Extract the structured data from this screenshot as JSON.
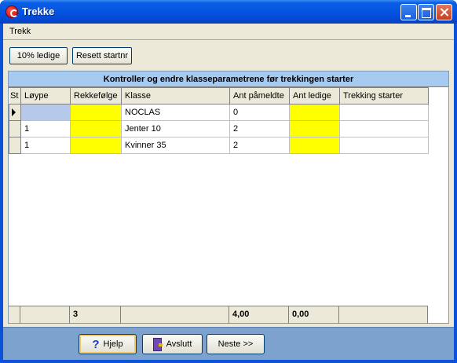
{
  "window": {
    "title": "Trekke"
  },
  "menu": {
    "items": [
      "Trekk"
    ]
  },
  "toolbar": {
    "buttons": [
      "10% ledige",
      "Resett startnr"
    ]
  },
  "grid": {
    "caption": "Kontroller og endre klasseparametrene før trekkingen starter",
    "columns": [
      "St",
      "Løype",
      "Rekkefølge",
      "Klasse",
      "Ant påmeldte",
      "Ant ledige",
      "Trekking starter"
    ],
    "rows": [
      {
        "indicator": "current",
        "løype": "",
        "rekkefølge": "",
        "klasse": "NOCLAS",
        "ant_påmeldte": "0",
        "ant_ledige": "",
        "trekking_starter": ""
      },
      {
        "indicator": "",
        "løype": "1",
        "rekkefølge": "",
        "klasse": "Jenter 10",
        "ant_påmeldte": "2",
        "ant_ledige": "",
        "trekking_starter": ""
      },
      {
        "indicator": "",
        "løype": "1",
        "rekkefølge": "",
        "klasse": "Kvinner 35",
        "ant_påmeldte": "2",
        "ant_ledige": "",
        "trekking_starter": ""
      }
    ],
    "footer": {
      "rekkefølge": "3",
      "ant_påmeldte": "4,00",
      "ant_ledige": "0,00"
    }
  },
  "bottom": {
    "buttons": {
      "help": "Hjelp",
      "exit": "Avslutt",
      "next": "Neste >>"
    }
  },
  "colors": {
    "highlight_yellow": "#ffff00",
    "header_blue": "#a6caf0",
    "bottom_bar": "#7da2ce"
  }
}
